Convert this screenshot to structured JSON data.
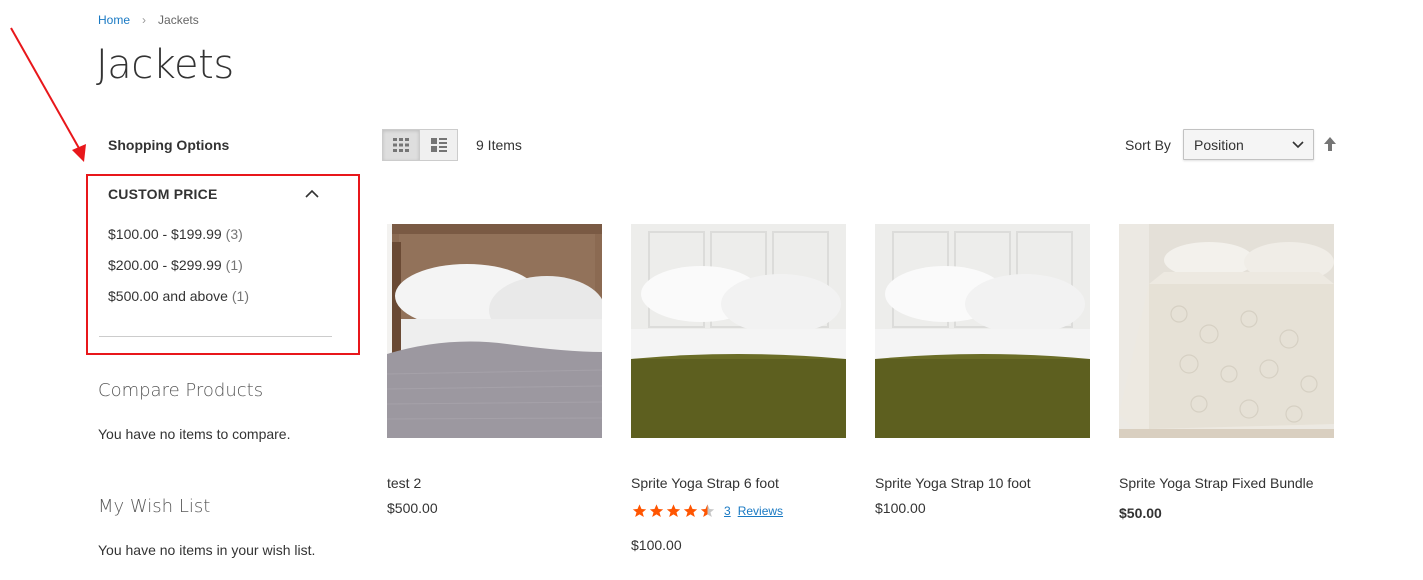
{
  "breadcrumbs": {
    "home": "Home",
    "separator": "›",
    "current": "Jackets"
  },
  "page": {
    "title": "Jackets"
  },
  "sidebar": {
    "shopping_options": "Shopping Options",
    "filter": {
      "title": "CUSTOM PRICE",
      "toggle_icon": "chevron-up-icon",
      "items": [
        {
          "label": "$100.00 - $199.99",
          "count": "(3)"
        },
        {
          "label": "$200.00 - $299.99",
          "count": "(1)"
        },
        {
          "label": "$500.00 and above",
          "count": "(1)"
        }
      ]
    },
    "compare": {
      "title": "Compare Products",
      "text": "You have no items to compare."
    },
    "wishlist": {
      "title": "My Wish List",
      "text": "You have no items in your wish list."
    }
  },
  "toolbar": {
    "mode_grid_icon": "grid-view-icon",
    "mode_list_icon": "list-view-icon",
    "items_count": "9 Items",
    "sort_label": "Sort By",
    "sort_value": "Position",
    "sort_direction_icon": "arrow-up-icon"
  },
  "products": [
    {
      "name": "test 2",
      "price": "$500.00",
      "price_bold": false
    },
    {
      "name": "Sprite Yoga Strap 6 foot",
      "price": "$100.00",
      "price_bold": false,
      "rating": {
        "stars": 4.5,
        "max": 5,
        "reviews_count": "3",
        "reviews_label": "Reviews"
      }
    },
    {
      "name": "Sprite Yoga Strap 10 foot",
      "price": "$100.00",
      "price_bold": false
    },
    {
      "name": "Sprite Yoga Strap Fixed Bundle",
      "price": "$50.00",
      "price_bold": true
    }
  ],
  "colors": {
    "link": "#1979c3",
    "annotation": "#e8171b",
    "star": "#ff5501",
    "blanket_olive": "#5d5f1f",
    "blanket_gray": "#9c98a0"
  }
}
